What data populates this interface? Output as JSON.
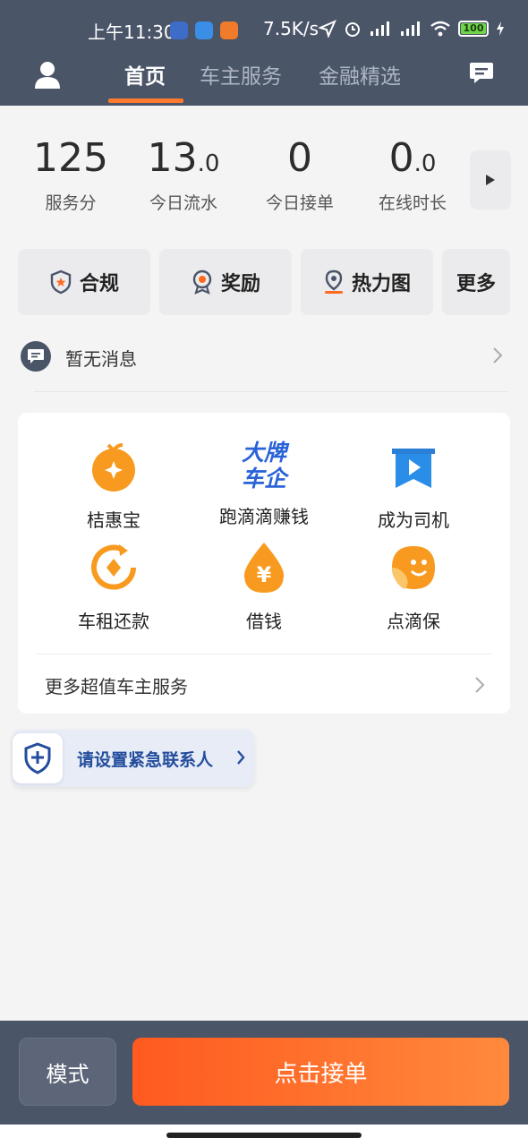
{
  "status_bar": {
    "time": "上午11:30",
    "net_speed": "7.5K/s",
    "battery": "100"
  },
  "nav": {
    "tabs": [
      {
        "label": "首页",
        "active": true
      },
      {
        "label": "车主服务",
        "active": false
      },
      {
        "label": "金融精选",
        "active": false
      }
    ]
  },
  "stats": [
    {
      "value": "125",
      "decimal": "",
      "label": "服务分"
    },
    {
      "value": "13",
      "decimal": ".0",
      "label": "今日流水"
    },
    {
      "value": "0",
      "decimal": "",
      "label": "今日接单"
    },
    {
      "value": "0",
      "decimal": ".0",
      "label": "在线时长"
    }
  ],
  "quick_actions": [
    {
      "label": "合规",
      "icon": "shield-star-icon"
    },
    {
      "label": "奖励",
      "icon": "award-icon"
    },
    {
      "label": "热力图",
      "icon": "map-pin-icon"
    },
    {
      "label": "更多",
      "icon": ""
    }
  ],
  "notice": {
    "text": "暂无消息"
  },
  "services": {
    "items": [
      {
        "label": "桔惠宝",
        "icon": "orange-fruit-icon"
      },
      {
        "label": "跑滴滴赚钱",
        "icon": "big-brand-logo"
      },
      {
        "label": "成为司机",
        "icon": "bookmark-play-icon"
      },
      {
        "label": "车租还款",
        "icon": "cycle-diamond-icon"
      },
      {
        "label": "借钱",
        "icon": "yuan-drop-icon"
      },
      {
        "label": "点滴保",
        "icon": "leaf-smile-icon"
      }
    ],
    "logo_text_line1": "大牌",
    "logo_text_line2": "车企",
    "more_label": "更多超值车主服务"
  },
  "emergency": {
    "text": "请设置紧急联系人"
  },
  "bottom": {
    "mode_label": "模式",
    "accept_label": "点击接单"
  },
  "colors": {
    "header_bg": "#4b5568",
    "accent_orange": "#ff7a2e",
    "service_orange": "#f79a1f",
    "brand_blue": "#2a63d8",
    "emergency_blue": "#234d9c"
  }
}
